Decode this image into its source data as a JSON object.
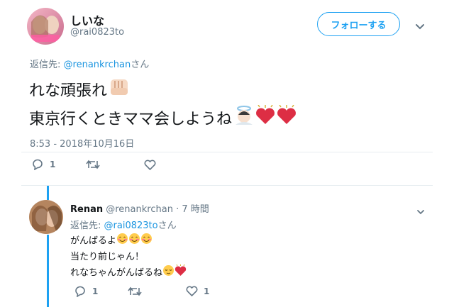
{
  "main_tweet": {
    "display_name": "しいな",
    "handle": "@rai0823to",
    "follow_label": "フォローする",
    "reply_prefix": "返信先:",
    "reply_handle": "@renankrchan",
    "reply_suffix": "さん",
    "line1": "れな頑張れ",
    "line2": "東京行くときママ会しようね",
    "timestamp": "8:53 - 2018年10月16日",
    "reply_count": "1"
  },
  "reply_tweet": {
    "display_name": "Renan",
    "handle": "@renankrchan",
    "separator": "·",
    "time": "7 時間",
    "reply_prefix": "返信先:",
    "reply_handle": "@rai0823to",
    "reply_suffix": "さん",
    "line1": "がんばるよ",
    "line2": "当たり前じゃん！",
    "line3": "れなちゃんがんばるね",
    "reply_count": "1",
    "like_count": "1"
  },
  "colors": {
    "accent": "#1da1f2",
    "link": "#1b95e0",
    "muted": "#657786",
    "divider": "#e6ecf0",
    "thread_line": "#1da1f2"
  },
  "icons": [
    "chevron-down-icon",
    "reply-icon",
    "retweet-icon",
    "like-icon",
    "fist-emoji",
    "angel-emoji",
    "heart-emoji",
    "smile-emoji",
    "relieved-emoji"
  ]
}
